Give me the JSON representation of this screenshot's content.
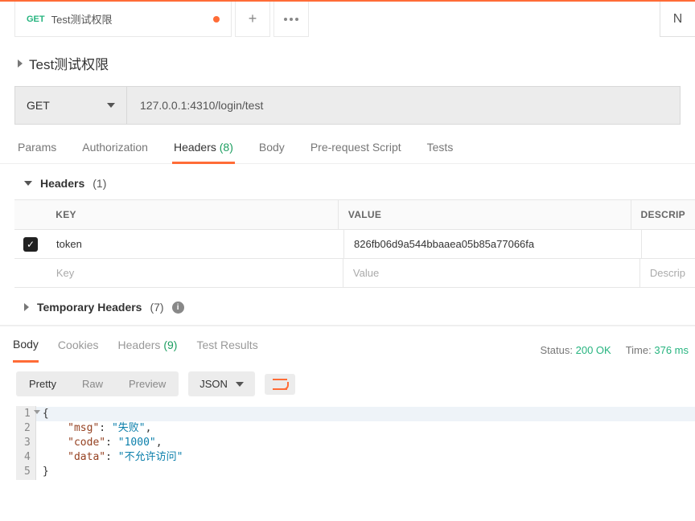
{
  "tab": {
    "method": "GET",
    "title": "Test测试权限",
    "rightBtn": "N"
  },
  "breadcrumb": "Test测试权限",
  "request": {
    "method": "GET",
    "url": "127.0.0.1:4310/login/test"
  },
  "reqTabs": {
    "params": "Params",
    "auth": "Authorization",
    "headers": "Headers",
    "headersCount": "(8)",
    "body": "Body",
    "prerequest": "Pre-request Script",
    "tests": "Tests"
  },
  "headersSection": {
    "title": "Headers",
    "count": "(1)",
    "cols": {
      "key": "KEY",
      "value": "VALUE",
      "desc": "DESCRIP"
    },
    "rows": [
      {
        "key": "token",
        "value": "826fb06d9a544bbaaea05b85a77066fa"
      }
    ],
    "placeholders": {
      "key": "Key",
      "value": "Value",
      "desc": "Descrip"
    }
  },
  "tempHeaders": {
    "title": "Temporary Headers",
    "count": "(7)"
  },
  "respTabs": {
    "body": "Body",
    "cookies": "Cookies",
    "headers": "Headers",
    "headersCount": "(9)",
    "testResults": "Test Results"
  },
  "respStatus": {
    "statusLabel": "Status:",
    "statusValue": "200 OK",
    "timeLabel": "Time:",
    "timeValue": "376 ms"
  },
  "viewer": {
    "pretty": "Pretty",
    "raw": "Raw",
    "preview": "Preview",
    "format": "JSON"
  },
  "json": {
    "msg_k": "\"msg\"",
    "msg_v": "\"失败\"",
    "code_k": "\"code\"",
    "code_v": "\"1000\"",
    "data_k": "\"data\"",
    "data_v": "\"不允许访问\""
  }
}
